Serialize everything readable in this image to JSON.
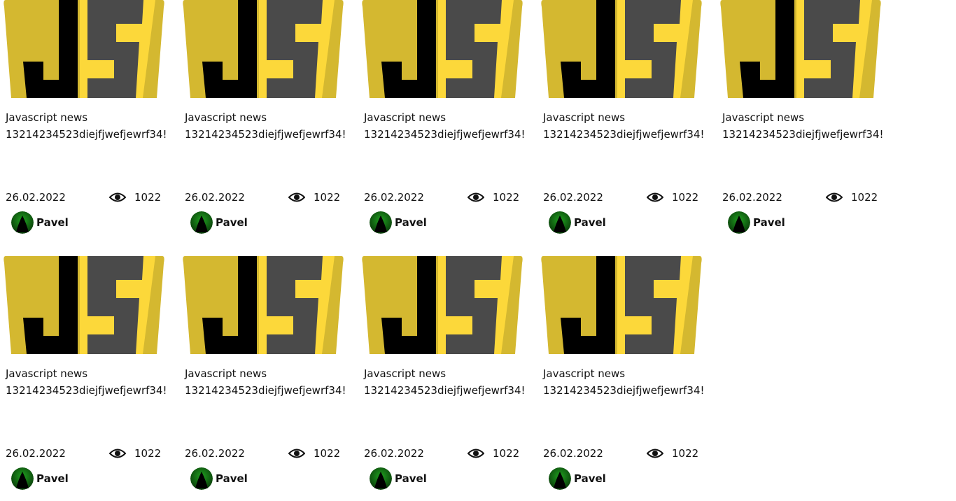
{
  "cards": [
    {
      "title": "Javascript news",
      "description": "13214234523diejfjwefjewrf34!",
      "date": "26.02.2022",
      "views": "1022",
      "author": "Pavel",
      "image_icon": "javascript-logo-icon",
      "views_icon": "eye-icon",
      "avatar_icon": "avatar-icon"
    },
    {
      "title": "Javascript news",
      "description": "13214234523diejfjwefjewrf34!",
      "date": "26.02.2022",
      "views": "1022",
      "author": "Pavel",
      "image_icon": "javascript-logo-icon",
      "views_icon": "eye-icon",
      "avatar_icon": "avatar-icon"
    },
    {
      "title": "Javascript news",
      "description": "13214234523diejfjwefjewrf34!",
      "date": "26.02.2022",
      "views": "1022",
      "author": "Pavel",
      "image_icon": "javascript-logo-icon",
      "views_icon": "eye-icon",
      "avatar_icon": "avatar-icon"
    },
    {
      "title": "Javascript news",
      "description": "13214234523diejfjwefjewrf34!",
      "date": "26.02.2022",
      "views": "1022",
      "author": "Pavel",
      "image_icon": "javascript-logo-icon",
      "views_icon": "eye-icon",
      "avatar_icon": "avatar-icon"
    },
    {
      "title": "Javascript news",
      "description": "13214234523diejfjwefjewrf34!",
      "date": "26.02.2022",
      "views": "1022",
      "author": "Pavel",
      "image_icon": "javascript-logo-icon",
      "views_icon": "eye-icon",
      "avatar_icon": "avatar-icon"
    },
    {
      "title": "Javascript news",
      "description": "13214234523diejfjwefjewrf34!",
      "date": "26.02.2022",
      "views": "1022",
      "author": "Pavel",
      "image_icon": "javascript-logo-icon",
      "views_icon": "eye-icon",
      "avatar_icon": "avatar-icon"
    },
    {
      "title": "Javascript news",
      "description": "13214234523diejfjwefjewrf34!",
      "date": "26.02.2022",
      "views": "1022",
      "author": "Pavel",
      "image_icon": "javascript-logo-icon",
      "views_icon": "eye-icon",
      "avatar_icon": "avatar-icon"
    },
    {
      "title": "Javascript news",
      "description": "13214234523diejfjwefjewrf34!",
      "date": "26.02.2022",
      "views": "1022",
      "author": "Pavel",
      "image_icon": "javascript-logo-icon",
      "views_icon": "eye-icon",
      "avatar_icon": "avatar-icon"
    },
    {
      "title": "Javascript news",
      "description": "13214234523diejfjwefjewrf34!",
      "date": "26.02.2022",
      "views": "1022",
      "author": "Pavel",
      "image_icon": "javascript-logo-icon",
      "views_icon": "eye-icon",
      "avatar_icon": "avatar-icon"
    }
  ],
  "colors": {
    "logo_yellow_dark": "#d4b830",
    "logo_yellow_light": "#fcd83a",
    "logo_black": "#000000",
    "logo_gray": "#4a4a4a",
    "avatar_green": "#1fa11f"
  }
}
